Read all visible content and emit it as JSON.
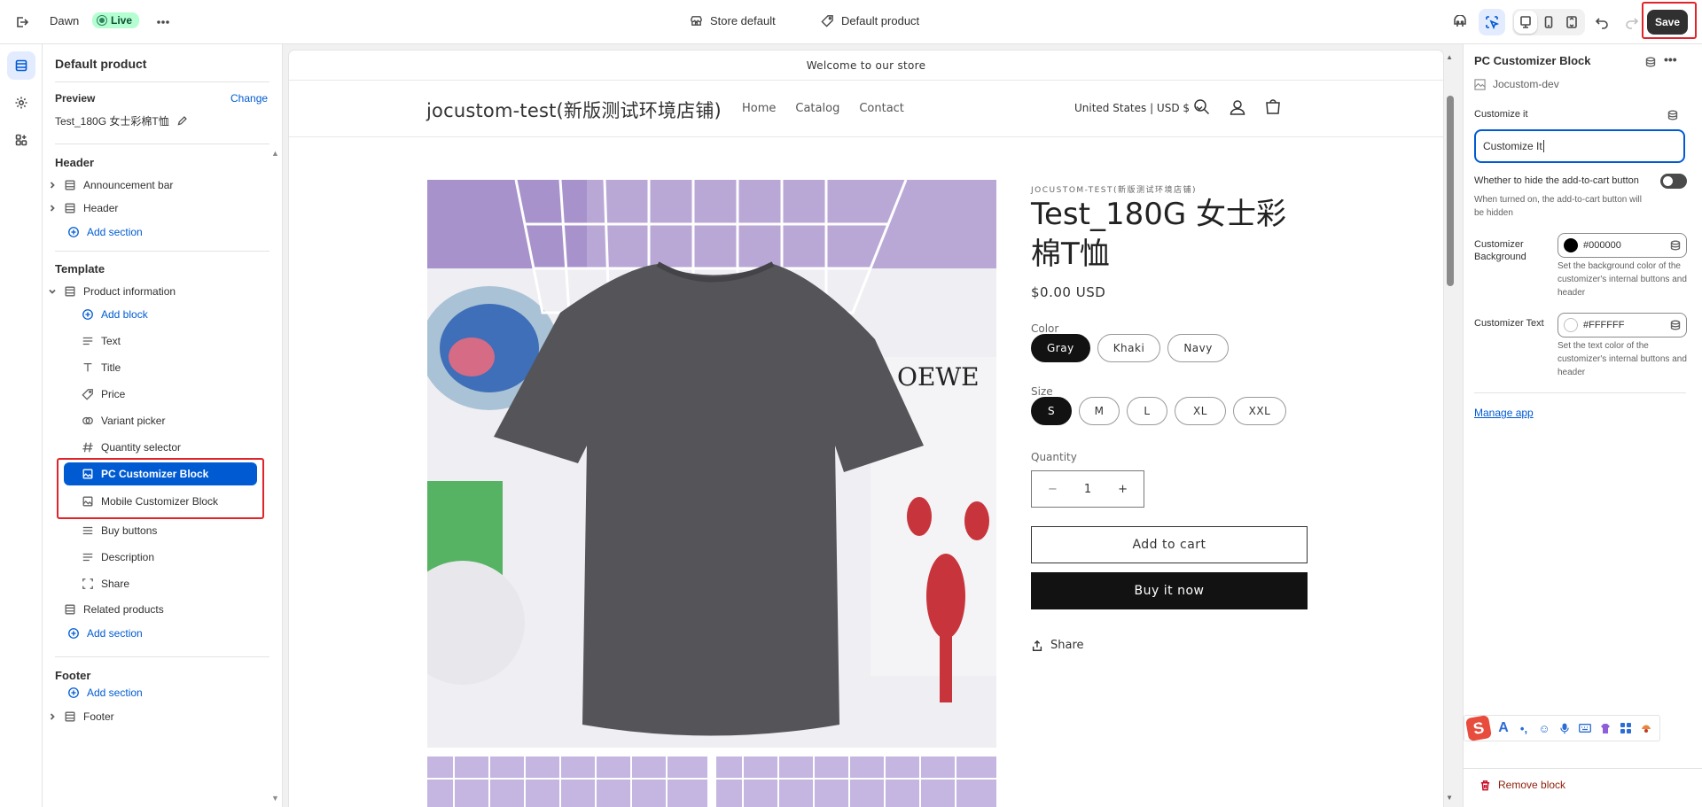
{
  "topbar": {
    "theme_name": "Dawn",
    "status_badge": "Live",
    "store_selector": "Store default",
    "template_selector": "Default product",
    "save_label": "Save",
    "icons": [
      "exit-icon",
      "more-icon",
      "store-icon",
      "tag-icon",
      "inspector-icon",
      "select-icon",
      "desktop-icon",
      "mobile-icon",
      "fullscreen-icon",
      "undo-icon",
      "redo-icon"
    ]
  },
  "rail": {
    "icons": [
      "sections-icon",
      "settings-icon",
      "apps-icon"
    ]
  },
  "sidebar": {
    "title": "Default product",
    "preview_label": "Preview",
    "change_label": "Change",
    "preview_product": "Test_180G 女士彩棉T恤",
    "header_group": "Header",
    "header_items": [
      "Announcement bar",
      "Header"
    ],
    "add_section": "Add section",
    "template_group": "Template",
    "product_info": "Product information",
    "add_block": "Add block",
    "blocks": [
      "Text",
      "Title",
      "Price",
      "Variant picker",
      "Quantity selector",
      "PC Customizer Block",
      "Mobile Customizer Block",
      "Buy buttons",
      "Description",
      "Share"
    ],
    "related": "Related products",
    "footer_group": "Footer",
    "footer_item": "Footer"
  },
  "store": {
    "announcement": "Welcome to our store",
    "logo": "jocustom-test(新版测试环境店铺)",
    "nav": [
      "Home",
      "Catalog",
      "Contact"
    ],
    "currency": "United States | USD $",
    "vendor": "JOCUSTOM-TEST(新版测试环境店铺)",
    "product_title": "Test_180G 女士彩棉T恤",
    "price": "$0.00 USD",
    "color_label": "Color",
    "colors": [
      "Gray",
      "Khaki",
      "Navy"
    ],
    "size_label": "Size",
    "sizes": [
      "S",
      "M",
      "L",
      "XL",
      "XXL"
    ],
    "quantity_label": "Quantity",
    "quantity": "1",
    "minus": "−",
    "plus": "+",
    "add_to_cart": "Add to cart",
    "buy_now": "Buy it now",
    "share": "Share",
    "image_text": "OEWE"
  },
  "panel": {
    "title": "PC Customizer Block",
    "app_name": "Jocustom-dev",
    "customize_label": "Customize it",
    "customize_value": "Customize It",
    "hide_label": "Whether to hide the add-to-cart button",
    "hide_help": "When turned on, the add-to-cart button will be hidden",
    "bg_label": "Customizer Background",
    "bg_value": "#000000",
    "bg_help": "Set the background color of the customizer's internal buttons and header",
    "text_label": "Customizer Text",
    "text_value": "#FFFFFF",
    "text_help": "Set the text color of the customizer's internal buttons and header",
    "manage_app": "Manage app",
    "remove_block": "Remove block",
    "ime_logo": "S",
    "ime_font": "A"
  },
  "colors": {
    "accent": "#005bd3",
    "highlight": "#e0242a",
    "save_bg": "#303030",
    "live_bg": "#b4fed2"
  }
}
